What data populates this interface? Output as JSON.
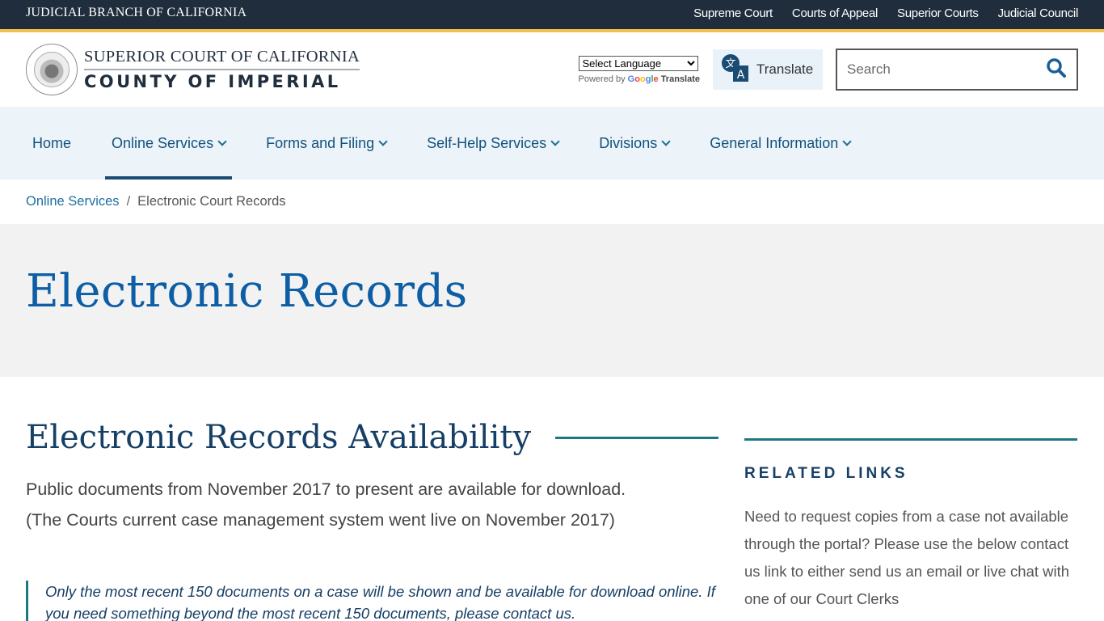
{
  "topbar": {
    "branch": "JUDICIAL BRANCH OF CALIFORNIA",
    "links": [
      "Supreme Court",
      "Courts of Appeal",
      "Superior Courts",
      "Judicial Council"
    ]
  },
  "header": {
    "logo_line1": "SUPERIOR COURT OF CALIFORNIA",
    "logo_line2": "COUNTY OF IMPERIAL",
    "language_select": "Select Language",
    "powered_by": "Powered by",
    "google": "Google",
    "translate_word": "Translate",
    "translate_button": "Translate",
    "search_placeholder": "Search"
  },
  "nav": {
    "items": [
      {
        "label": "Home",
        "dropdown": false,
        "active": false
      },
      {
        "label": "Online Services",
        "dropdown": true,
        "active": true
      },
      {
        "label": "Forms and Filing",
        "dropdown": true,
        "active": false
      },
      {
        "label": "Self-Help Services",
        "dropdown": true,
        "active": false
      },
      {
        "label": "Divisions",
        "dropdown": true,
        "active": false
      },
      {
        "label": "General Information",
        "dropdown": true,
        "active": false
      }
    ]
  },
  "breadcrumb": {
    "parent": "Online Services",
    "separator": "/",
    "current": "Electronic Court Records"
  },
  "hero": {
    "title": "Electronic Records"
  },
  "main": {
    "section_title": "Electronic Records Availability",
    "intro_line1": "Public documents from November 2017 to present are available for download.",
    "intro_line2": "(The Courts current case management system went live on November 2017)",
    "quote": "Only the most recent 150 documents on a case will be shown and be available for download online. If you need something beyond the most recent 150 documents, please contact us."
  },
  "aside": {
    "heading": "RELATED LINKS",
    "text": "Need to request copies from a case not available through the portal? Please use the below contact us link to either send us an email or live chat with one of our Court Clerks"
  },
  "colors": {
    "topbar": "#1f2d3d",
    "accent_gold": "#f1c050",
    "nav_bg": "#ecf3f9",
    "link_blue": "#12527d",
    "title_blue": "#0d5ea5",
    "teal_rule": "#1e7884"
  }
}
